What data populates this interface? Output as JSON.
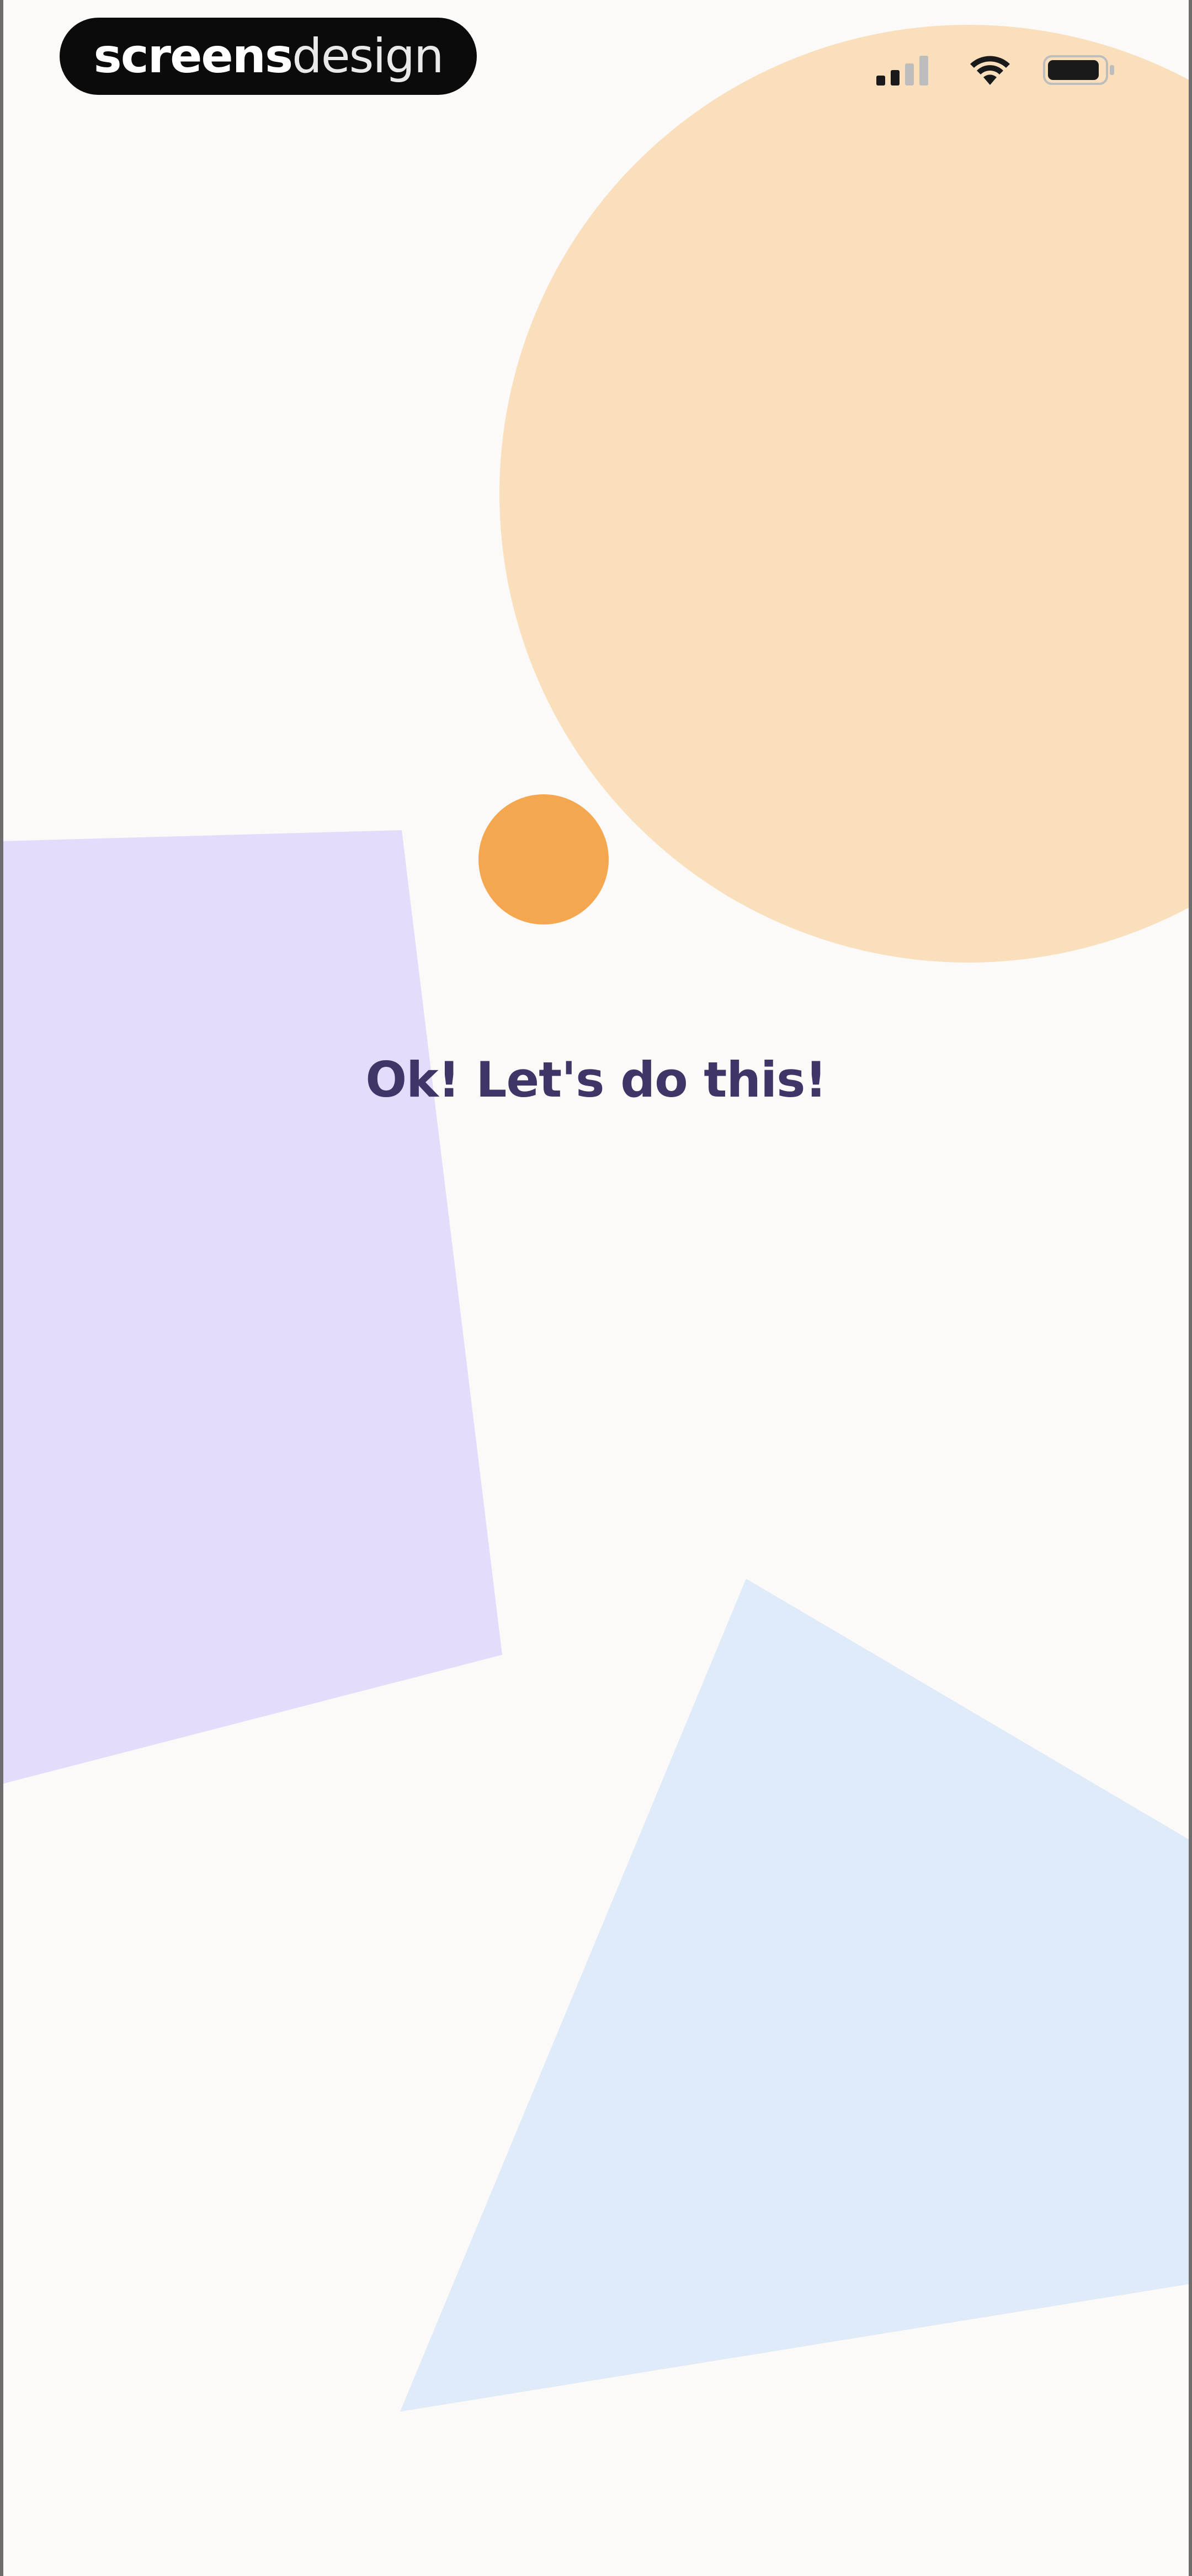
{
  "status_bar": {
    "brand_bold": "screens",
    "brand_light": "design",
    "signal_icon": "cellular-signal-icon",
    "wifi_icon": "wifi-icon",
    "battery_icon": "battery-icon"
  },
  "main": {
    "headline": "Ok! Let's do this!"
  },
  "colors": {
    "background": "#fbfaf9",
    "peach_circle": "#fadfbd",
    "orange_dot": "#f5a74f",
    "lavender_shape": "#e3dcfb",
    "blue_shape": "#dfebf8",
    "headline_text": "#3f3566"
  }
}
